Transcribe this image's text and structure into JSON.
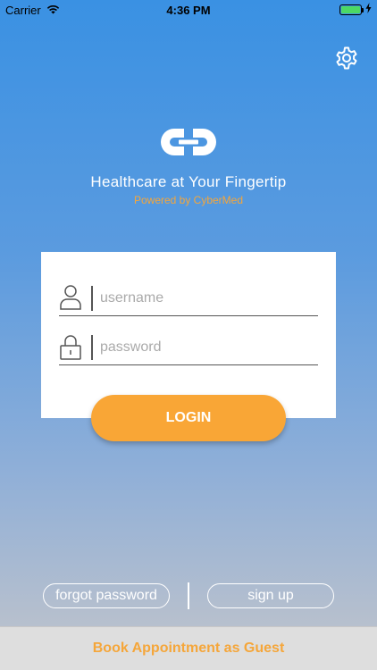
{
  "status_bar": {
    "carrier": "Carrier",
    "time": "4:36 PM",
    "battery_level": 1.0
  },
  "header": {
    "settings_icon": "gear-icon",
    "logo_icon": "link-logo-icon"
  },
  "branding": {
    "tagline": "Healthcare at Your Fingertip",
    "powered_by": "Powered by CyberMed"
  },
  "login_form": {
    "username": {
      "value": "",
      "placeholder": "username",
      "icon": "user-icon"
    },
    "password": {
      "value": "",
      "placeholder": "password",
      "icon": "lock-icon"
    },
    "login_label": "LOGIN"
  },
  "footer": {
    "forgot_password_label": "forgot password",
    "sign_up_label": "sign up",
    "guest_label": "Book Appointment as Guest"
  },
  "colors": {
    "accent_orange": "#f9a636",
    "gradient_top": "#3a91e3",
    "gradient_bottom": "#c0c4cc",
    "battery_green": "#4cd964"
  }
}
